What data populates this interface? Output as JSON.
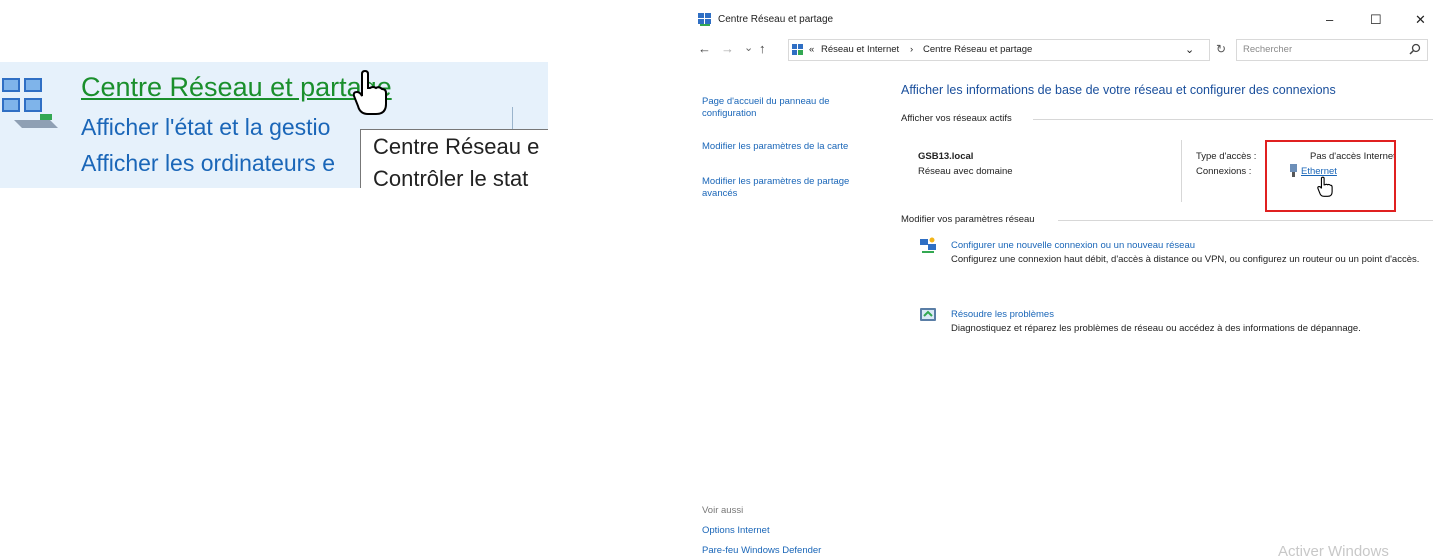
{
  "zoom_panel": {
    "title_link": "Centre Réseau et partage",
    "line1": "Afficher l'état et la gestio",
    "line2": "Afficher les ordinateurs e",
    "tooltip_line1": "Centre Réseau e",
    "tooltip_line2": "Contrôler le stat"
  },
  "window": {
    "title": "Centre Réseau et partage",
    "controls": {
      "minimize": "–",
      "maximize": "☐",
      "close": "✕"
    },
    "nav": {
      "back": "←",
      "forward": "→",
      "recent": "⌄",
      "up": "↑"
    },
    "address": {
      "prefix": "«",
      "crumb1": "Réseau et Internet",
      "separator": "›",
      "crumb2": "Centre Réseau et partage",
      "dropdown": "⌄",
      "refresh": "↻"
    },
    "search": {
      "placeholder": "Rechercher"
    }
  },
  "sidebar": {
    "items": [
      "Page d'accueil du panneau de configuration",
      "Modifier les paramètres de la carte",
      "Modifier les paramètres de partage avancés"
    ],
    "see_also_heading": "Voir aussi",
    "see_also_items": [
      "Options Internet",
      "Pare-feu Windows Defender"
    ]
  },
  "main": {
    "heading": "Afficher les informations de base de votre réseau et configurer des connexions",
    "active_networks_label": "Afficher vos réseaux actifs",
    "network_name": "GSB13.local",
    "network_type": "Réseau avec domaine",
    "access_type_label": "Type d'accès :",
    "access_type_value": "Pas d'accès Internet",
    "connections_label": "Connexions :",
    "connection_link": "Ethernet",
    "modify_settings_label": "Modifier vos paramètres réseau",
    "actions": [
      {
        "title": "Configurer une nouvelle connexion ou un nouveau réseau",
        "description": "Configurez une connexion haut débit, d'accès à distance ou VPN, ou configurez un routeur ou un point d'accès."
      },
      {
        "title": "Résoudre les problèmes",
        "description": "Diagnostiquez et réparez les problèmes de réseau ou accédez à des informations de dépannage."
      }
    ]
  },
  "watermark": "Activer Windows",
  "colors": {
    "link": "#1a66b8",
    "heading": "#1a4f9c",
    "zoom_bg": "#e6f1fb",
    "highlight_box": "#e02020"
  }
}
